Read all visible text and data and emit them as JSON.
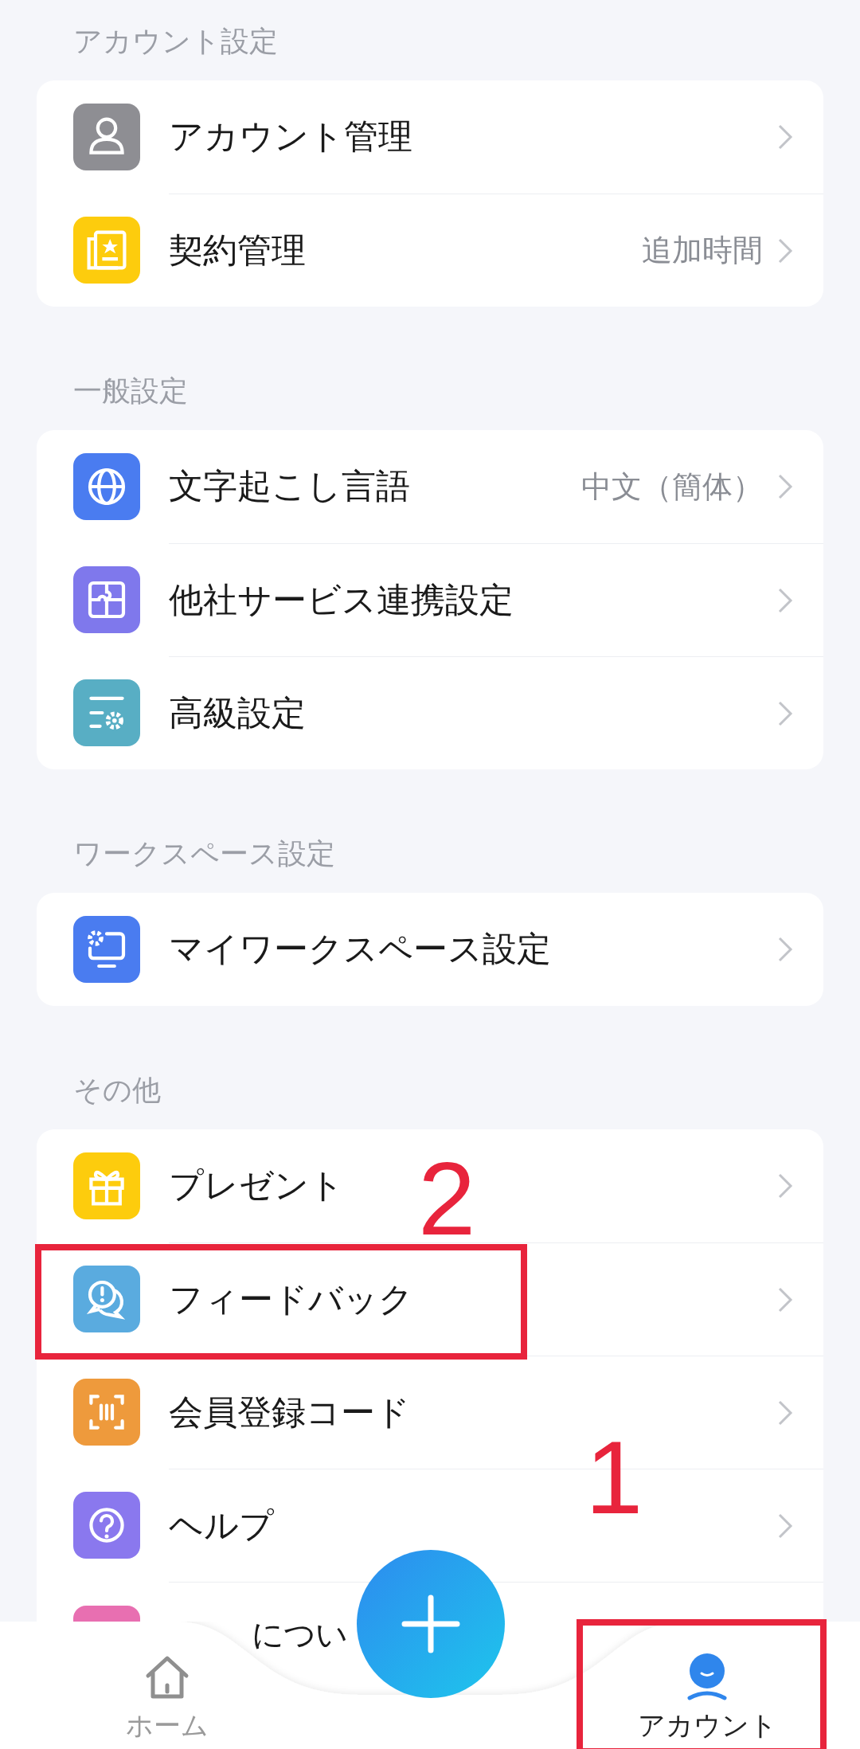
{
  "sections": [
    {
      "title": "アカウント設定",
      "items": [
        {
          "label": "アカウント管理",
          "color": "#8e8e93"
        },
        {
          "label": "契約管理",
          "value": "追加時間",
          "color": "#fdcc0d"
        }
      ]
    },
    {
      "title": "一般設定",
      "items": [
        {
          "label": "文字起こし言語",
          "value": "中文（簡体）",
          "color": "#4a7cf0"
        },
        {
          "label": "他社サービス連携設定",
          "color": "#7f78ec"
        },
        {
          "label": "高級設定",
          "color": "#58aec4"
        }
      ]
    },
    {
      "title": "ワークスペース設定",
      "items": [
        {
          "label": "マイワークスペース設定",
          "color": "#4a7cf0"
        }
      ]
    },
    {
      "title": "その他",
      "items": [
        {
          "label": "プレゼント",
          "color": "#fdcc0d"
        },
        {
          "label": "フィードバック",
          "color": "#5aabdf"
        },
        {
          "label": "会員登録コード",
          "color": "#ee9a3c"
        },
        {
          "label": "ヘルプ",
          "color": "#8a78ee"
        },
        {
          "label": "につい",
          "color": "#e86fb1",
          "kind": "partial"
        }
      ]
    }
  ],
  "tabs": [
    {
      "label": "ホーム",
      "selected": false
    },
    {
      "label": "アカウント",
      "selected": true
    }
  ],
  "annotations": [
    "2",
    "1"
  ]
}
